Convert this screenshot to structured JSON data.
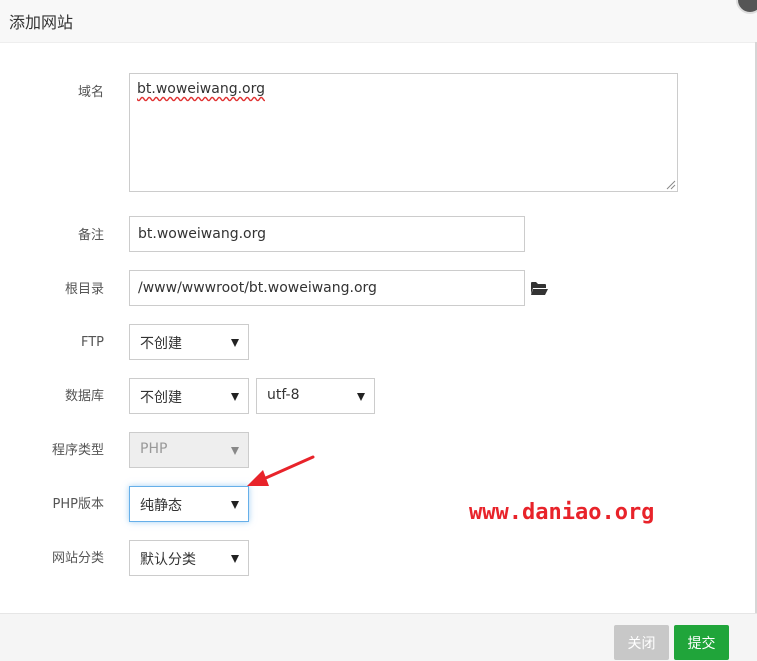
{
  "dialog": {
    "title": "添加网站"
  },
  "form": {
    "domain": {
      "label": "域名",
      "value": "bt.woweiwang.org"
    },
    "note": {
      "label": "备注",
      "value": "bt.woweiwang.org"
    },
    "root_dir": {
      "label": "根目录",
      "value": "/www/wwwroot/bt.woweiwang.org",
      "browse_icon": "folder-open-icon"
    },
    "ftp": {
      "label": "FTP",
      "selected": "不创建"
    },
    "database": {
      "label": "数据库",
      "selected": "不创建",
      "charset": "utf-8"
    },
    "program_type": {
      "label": "程序类型",
      "selected": "PHP"
    },
    "php_version": {
      "label": "PHP版本",
      "selected": "纯静态"
    },
    "site_category": {
      "label": "网站分类",
      "selected": "默认分类"
    }
  },
  "buttons": {
    "close": "关闭",
    "submit": "提交"
  },
  "watermark": "www.daniao.org",
  "colors": {
    "submit": "#20a53a",
    "close": "#c8c8c8",
    "watermark": "#e8232a",
    "focus": "#66afe9"
  }
}
